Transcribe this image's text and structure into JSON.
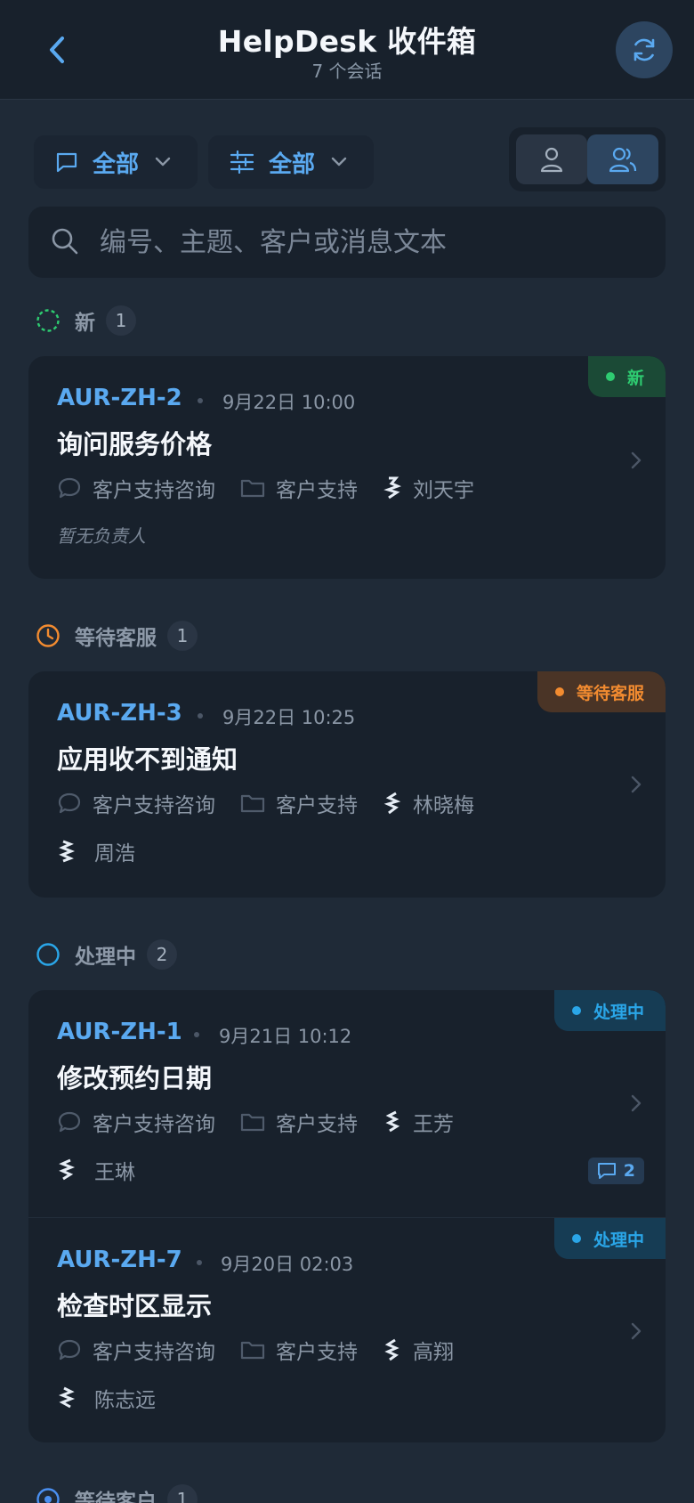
{
  "header": {
    "title": "HelpDesk 收件箱",
    "subtitle": "7 个会话"
  },
  "filters": {
    "channel_label": "全部",
    "status_label": "全部"
  },
  "search": {
    "placeholder": "编号、主题、客户或消息文本"
  },
  "groups": [
    {
      "name": "新",
      "count": "1",
      "color": "#2ecc71"
    },
    {
      "name": "等待客服",
      "count": "1",
      "color": "#f28b30"
    },
    {
      "name": "处理中",
      "count": "2",
      "color": "#2aa6e8"
    },
    {
      "name": "等待客户",
      "count": "1",
      "color": "#4a8ff0"
    }
  ],
  "tickets": [
    {
      "id": "AUR-ZH-2",
      "date": "9月22日 10:00",
      "subject": "询问服务价格",
      "category": "客户支持咨询",
      "queue": "客户支持",
      "customer": "刘天宇",
      "assignee": "暂无负责人",
      "status": "新",
      "status_color": "#2ecc71",
      "status_bg": "#1b4a36"
    },
    {
      "id": "AUR-ZH-3",
      "date": "9月22日 10:25",
      "subject": "应用收不到通知",
      "category": "客户支持咨询",
      "queue": "客户支持",
      "customer": "林晓梅",
      "assignee": "周浩",
      "status": "等待客服",
      "status_color": "#f28b30",
      "status_bg": "#4a3426"
    },
    {
      "id": "AUR-ZH-1",
      "date": "9月21日 10:12",
      "subject": "修改预约日期",
      "category": "客户支持咨询",
      "queue": "客户支持",
      "customer": "王芳",
      "assignee": "王琳",
      "status": "处理中",
      "status_color": "#2aa6e8",
      "status_bg": "#163c54",
      "messages": "2"
    },
    {
      "id": "AUR-ZH-7",
      "date": "9月20日 02:03",
      "subject": "检查时区显示",
      "category": "客户支持咨询",
      "queue": "客户支持",
      "customer": "高翔",
      "assignee": "陈志远",
      "status": "处理中",
      "status_color": "#2aa6e8",
      "status_bg": "#163c54"
    }
  ]
}
